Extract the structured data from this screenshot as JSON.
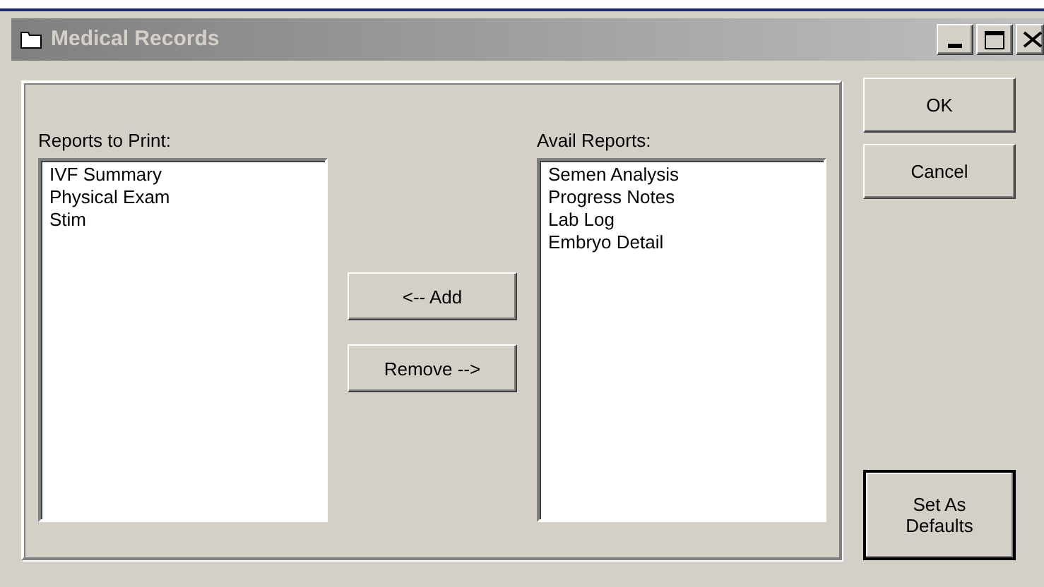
{
  "window": {
    "title": "Medical Records",
    "active": false
  },
  "lists": [
    {
      "label": "Reports to Print:",
      "items": [
        "IVF Summary",
        "Physical Exam",
        "Stim"
      ]
    },
    {
      "label": "Avail Reports:",
      "items": [
        "Semen Analysis",
        "Progress Notes",
        "Lab Log",
        "Embryo Detail"
      ]
    }
  ],
  "move_buttons": [
    "<-- Add",
    "Remove -->"
  ],
  "dialog_buttons": [
    {
      "label": "OK",
      "default": false
    },
    {
      "label": "Cancel",
      "default": false
    },
    {
      "label": "Set As Defaults",
      "default": true
    }
  ]
}
